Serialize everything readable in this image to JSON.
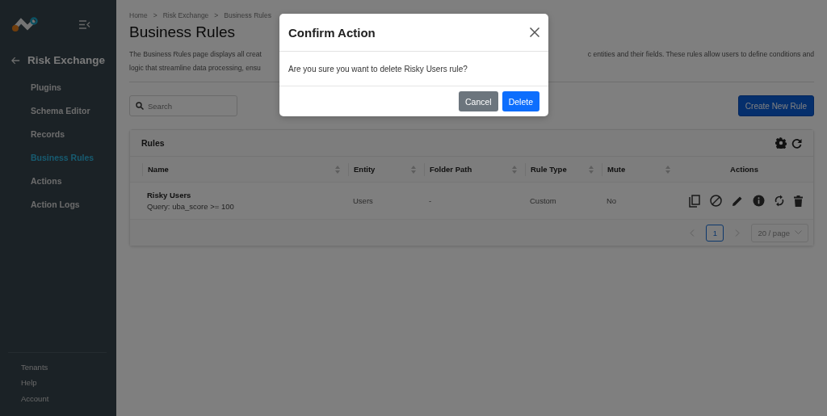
{
  "sidebar": {
    "back_title": "Risk Exchange",
    "items": [
      {
        "label": "Plugins",
        "selected": false
      },
      {
        "label": "Schema Editor",
        "selected": false
      },
      {
        "label": "Records",
        "selected": false
      },
      {
        "label": "Business Rules",
        "selected": true
      },
      {
        "label": "Actions",
        "selected": false
      },
      {
        "label": "Action Logs",
        "selected": false
      }
    ],
    "footer_items": [
      "Tenants",
      "Help",
      "Account"
    ]
  },
  "breadcrumb": [
    "Home",
    "Risk Exchange",
    "Business Rules"
  ],
  "breadcrumb_separator": ">",
  "title": "Business Rules",
  "description": {
    "line_1_start": "The Business Rules page displays all creat",
    "line_1_end": "c entities and their fields. These rules allow users to define conditions and",
    "line_2_start": "logic that streamline data processing, ensu"
  },
  "search": {
    "placeholder": "Search"
  },
  "create_button": "Create New Rule",
  "rules": {
    "title": "Rules",
    "columns": [
      {
        "label": "Name",
        "sortable": true
      },
      {
        "label": "Entity",
        "sortable": true
      },
      {
        "label": "Folder Path",
        "sortable": true
      },
      {
        "label": "Rule Type",
        "sortable": true
      },
      {
        "label": "Mute",
        "sortable": true
      },
      {
        "label": "Actions",
        "sortable": false
      }
    ],
    "rows": [
      {
        "name": "Risky Users",
        "query": "Query: uba_score >= 100",
        "entity": "Users",
        "folder_path": "-",
        "rule_type": "Custom",
        "mute": "No"
      }
    ],
    "pages": [
      {
        "label": "1",
        "selected": true
      }
    ],
    "page_size": "20 / page"
  },
  "modal": {
    "title": "Confirm Action",
    "message": "Are you sure you want to delete Risky Users rule?",
    "buttons": [
      {
        "label": "Cancel",
        "kind": "secondary"
      },
      {
        "label": "Delete",
        "kind": "primary"
      }
    ]
  }
}
